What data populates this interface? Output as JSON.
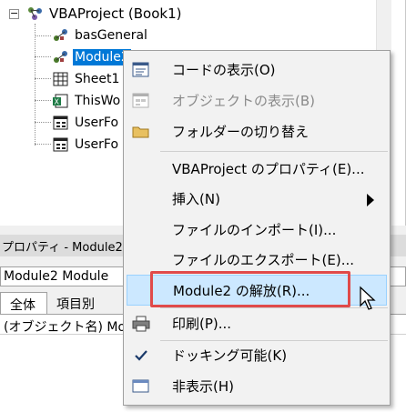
{
  "tree": {
    "root_label": "VBAProject (Book1)",
    "expander_symbol": "−",
    "items": [
      {
        "label": "basGeneral",
        "icon": "module-icon"
      },
      {
        "label": "Module2",
        "icon": "module-icon"
      },
      {
        "label": "Sheet1",
        "icon": "sheet-icon"
      },
      {
        "label": "ThisWo",
        "icon": "workbook-icon"
      },
      {
        "label": "UserFo",
        "icon": "userform-icon"
      },
      {
        "label": "UserFo",
        "icon": "userform-icon"
      }
    ]
  },
  "properties": {
    "title": "プロパティ - Module2",
    "object_name": "Module2",
    "object_type": "Module",
    "tabs": [
      {
        "label": "全体"
      },
      {
        "label": "項目別"
      }
    ],
    "grid_first_row": "(オブジェクト名) Mo"
  },
  "context_menu": {
    "items": [
      {
        "label": "コードの表示(O)",
        "icon": "code-view-icon",
        "disabled": false
      },
      {
        "label": "オブジェクトの表示(B)",
        "icon": "object-view-icon",
        "disabled": true
      },
      {
        "label": "フォルダーの切り替え",
        "icon": "folder-icon",
        "disabled": false
      },
      {
        "label": "VBAProject のプロパティ(E)...",
        "icon": "",
        "disabled": false
      },
      {
        "label": "挿入(N)",
        "icon": "",
        "disabled": false,
        "submenu": true
      },
      {
        "label": "ファイルのインポート(I)...",
        "icon": "",
        "disabled": false
      },
      {
        "label": "ファイルのエクスポート(E)...",
        "icon": "",
        "disabled": false
      },
      {
        "label": "Module2 の解放(R)...",
        "icon": "",
        "disabled": false,
        "hovered": true
      },
      {
        "label": "印刷(P)...",
        "icon": "printer-icon",
        "disabled": false
      },
      {
        "label": "ドッキング可能(K)",
        "icon": "checkmark-icon",
        "disabled": false,
        "checked": true
      },
      {
        "label": "非表示(H)",
        "icon": "window-hide-icon",
        "disabled": false
      }
    ]
  },
  "colors": {
    "selection": "#0078d7",
    "hover": "#cce8ff",
    "highlight": "#e04a4a"
  }
}
